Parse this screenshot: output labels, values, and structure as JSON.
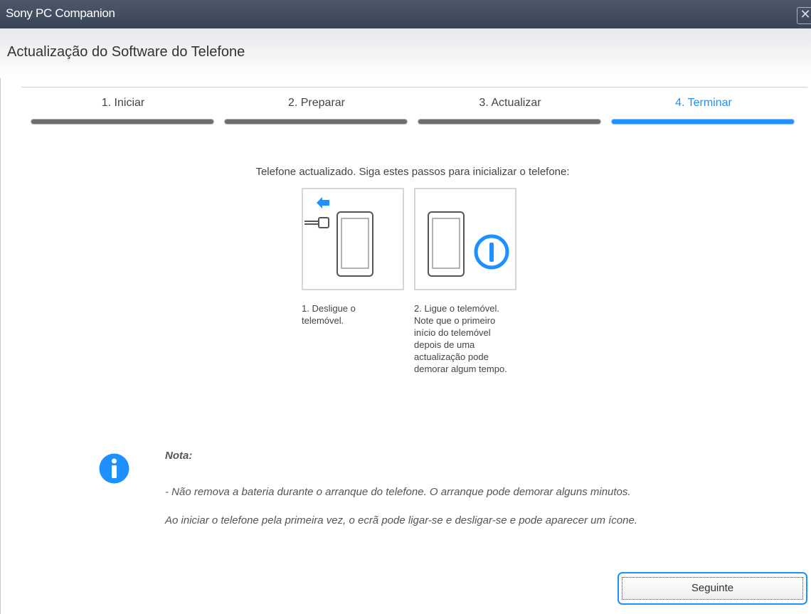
{
  "window": {
    "title": "Sony PC Companion",
    "close_glyph": "✕"
  },
  "header": {
    "title": "Actualização do Software do Telefone"
  },
  "steps": [
    {
      "label": "1. Iniciar",
      "active": false
    },
    {
      "label": "2. Preparar",
      "active": false
    },
    {
      "label": "3. Actualizar",
      "active": false
    },
    {
      "label": "4. Terminar",
      "active": true
    }
  ],
  "main": {
    "instruction": "Telefone actualizado. Siga estes passos para inicializar o telefone:",
    "cards": [
      {
        "icon": "disconnect-phone-icon",
        "text": "1. Desligue o telemóvel."
      },
      {
        "icon": "power-on-phone-icon",
        "text": "2. Ligue o telemóvel. Note que o primeiro início do telemóvel depois de uma actualização pode demorar algum tempo."
      }
    ]
  },
  "note": {
    "icon": "info-icon",
    "title": "Nota:",
    "line1": "- Não remova a bateria durante o arranque do telefone. O arranque pode demorar alguns minutos.",
    "line2": "Ao iniciar o telefone pela primeira vez, o ecrã pode ligar-se e desligar-se e pode aparecer um ícone."
  },
  "footer": {
    "next_label": "Seguinte"
  },
  "colors": {
    "accent": "#1e90ff",
    "titlebar": "#434d60",
    "inactive_bar": "#6d6d6d"
  }
}
